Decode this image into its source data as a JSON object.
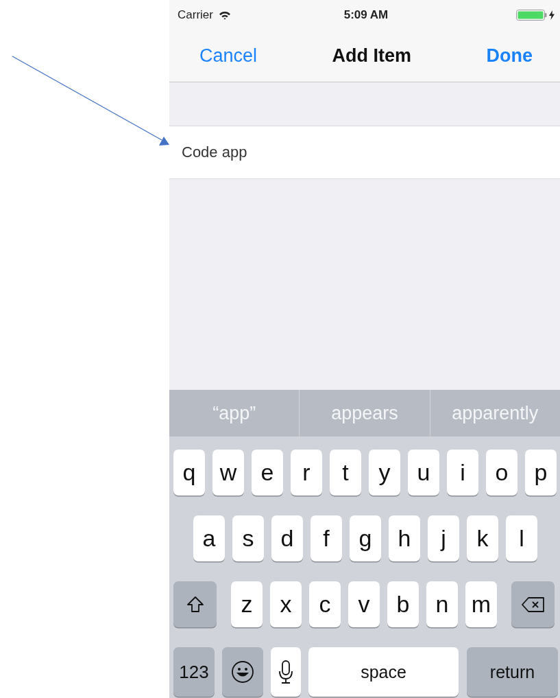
{
  "status_bar": {
    "carrier": "Carrier",
    "time": "5:09 AM"
  },
  "nav_bar": {
    "cancel": "Cancel",
    "title": "Add Item",
    "done": "Done"
  },
  "item_field": {
    "value": "Code app"
  },
  "suggestions": [
    "“app”",
    "appears",
    "apparently"
  ],
  "keyboard": [
    [
      {
        "kind": "letter",
        "label": "q"
      },
      {
        "kind": "letter",
        "label": "w"
      },
      {
        "kind": "letter",
        "label": "e"
      },
      {
        "kind": "letter",
        "label": "r"
      },
      {
        "kind": "letter",
        "label": "t"
      },
      {
        "kind": "letter",
        "label": "y"
      },
      {
        "kind": "letter",
        "label": "u"
      },
      {
        "kind": "letter",
        "label": "i"
      },
      {
        "kind": "letter",
        "label": "o"
      },
      {
        "kind": "letter",
        "label": "p"
      }
    ],
    [
      {
        "kind": "letter",
        "label": "a"
      },
      {
        "kind": "letter",
        "label": "s"
      },
      {
        "kind": "letter",
        "label": "d"
      },
      {
        "kind": "letter",
        "label": "f"
      },
      {
        "kind": "letter",
        "label": "g"
      },
      {
        "kind": "letter",
        "label": "h"
      },
      {
        "kind": "letter",
        "label": "j"
      },
      {
        "kind": "letter",
        "label": "k"
      },
      {
        "kind": "letter",
        "label": "l"
      }
    ],
    [
      {
        "kind": "shift"
      },
      {
        "kind": "letter",
        "label": "z"
      },
      {
        "kind": "letter",
        "label": "x"
      },
      {
        "kind": "letter",
        "label": "c"
      },
      {
        "kind": "letter",
        "label": "v"
      },
      {
        "kind": "letter",
        "label": "b"
      },
      {
        "kind": "letter",
        "label": "n"
      },
      {
        "kind": "letter",
        "label": "m"
      },
      {
        "kind": "delete"
      }
    ],
    [
      {
        "kind": "numbers",
        "label": "123"
      },
      {
        "kind": "emoji"
      },
      {
        "kind": "mic"
      },
      {
        "kind": "space",
        "label": "space"
      },
      {
        "kind": "return",
        "label": "return"
      }
    ]
  ]
}
